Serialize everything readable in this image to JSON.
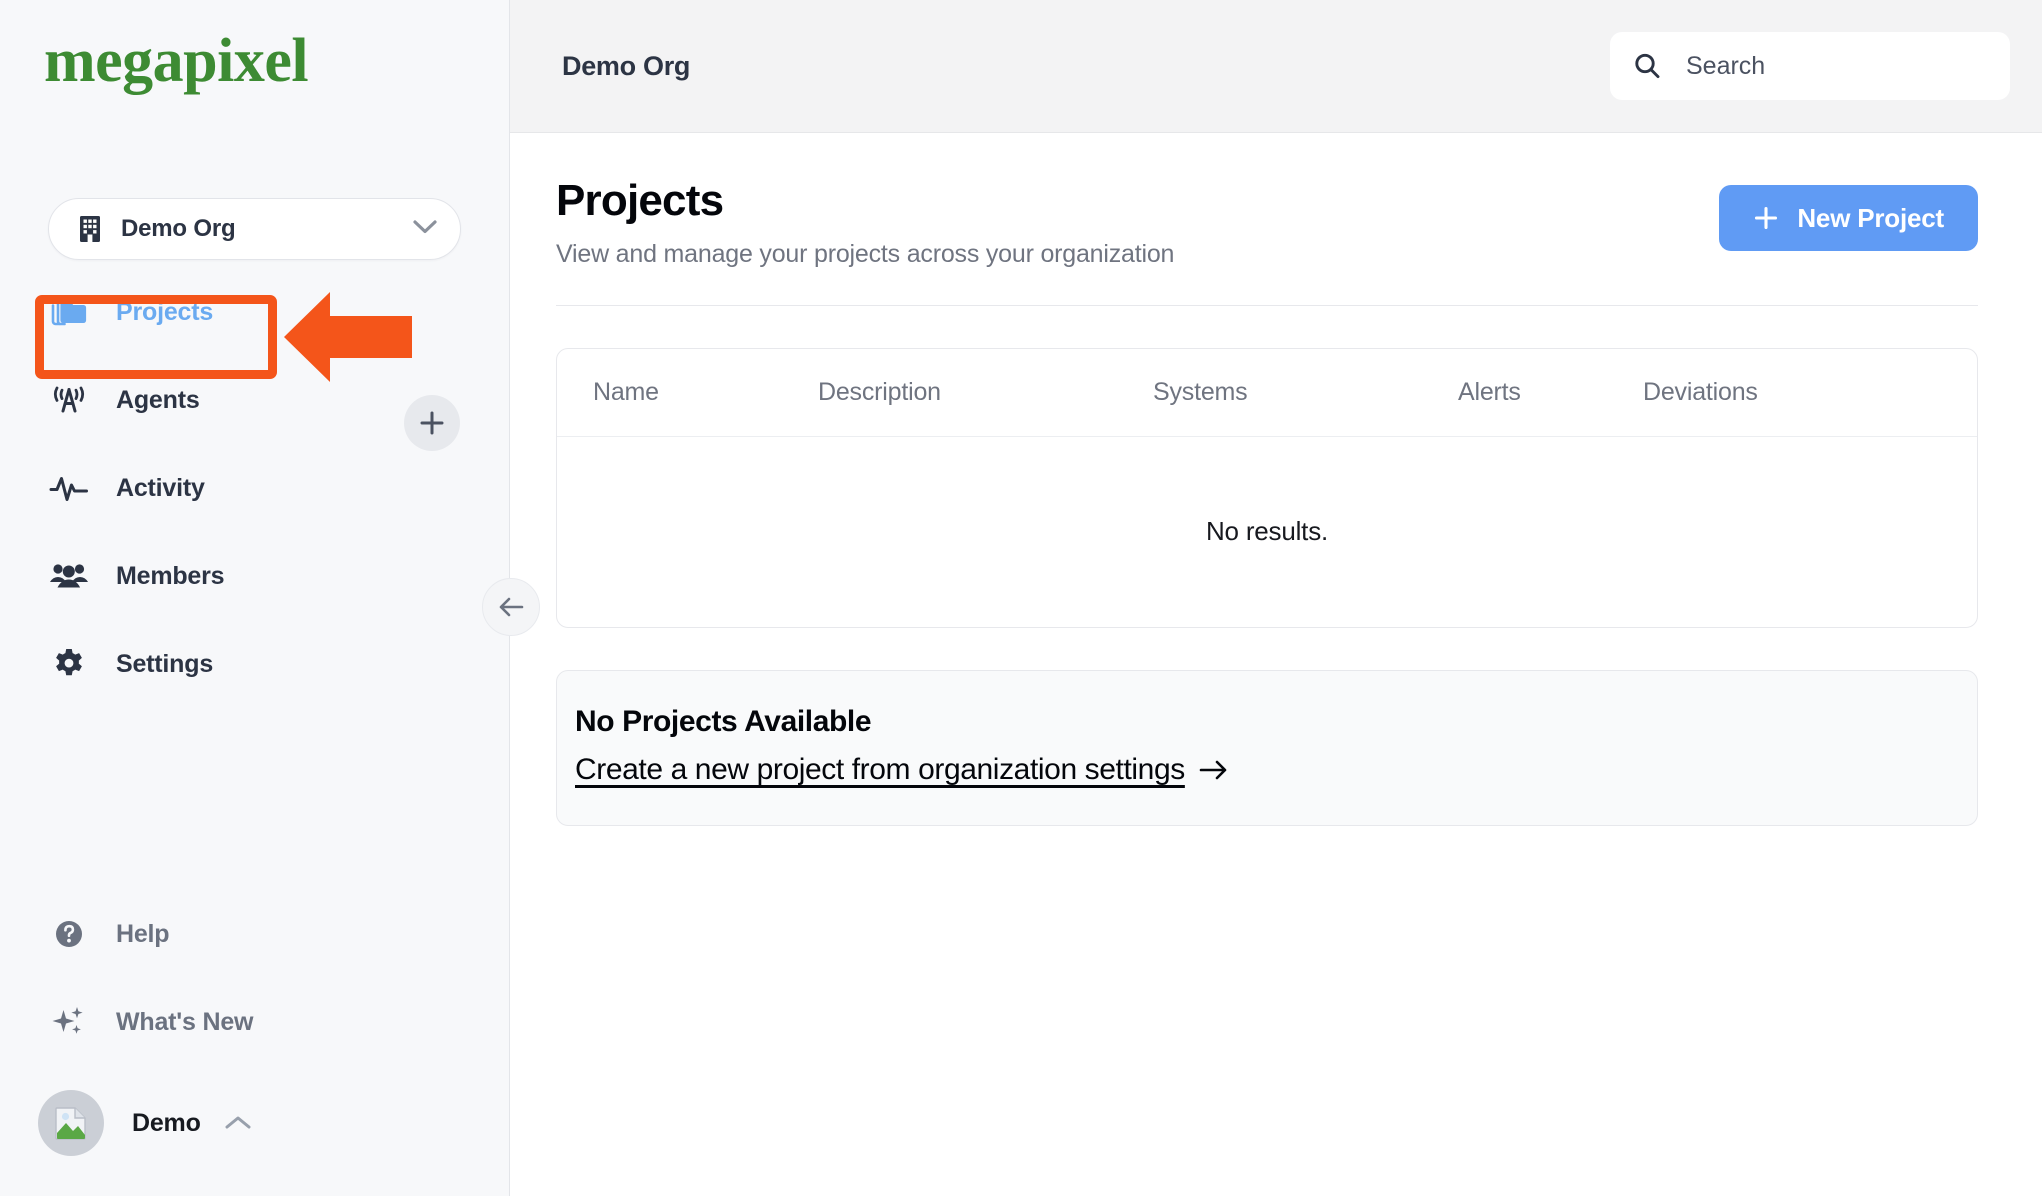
{
  "brand": {
    "logo_text": "megapixel",
    "logo_color": "#3d8b33"
  },
  "sidebar": {
    "org_selector": {
      "name": "Demo Org",
      "icon": "building-icon",
      "chevron": "chevron-down-icon"
    },
    "items": [
      {
        "label": "Projects",
        "icon": "folder-icon",
        "active": true
      },
      {
        "label": "Agents",
        "icon": "antenna-icon",
        "active": false
      },
      {
        "label": "Activity",
        "icon": "pulse-icon",
        "active": false
      },
      {
        "label": "Members",
        "icon": "people-icon",
        "active": false
      },
      {
        "label": "Settings",
        "icon": "gear-icon",
        "active": false
      }
    ],
    "add_agent_button": {
      "icon": "plus-icon"
    },
    "bottom_items": [
      {
        "label": "Help",
        "icon": "question-circle-icon"
      },
      {
        "label": "What's New",
        "icon": "sparkles-icon"
      }
    ],
    "user": {
      "name": "Demo",
      "avatar_icon": "image-placeholder-icon",
      "caret": "chevron-up-icon"
    },
    "collapse_button": {
      "icon": "arrow-left-icon"
    },
    "active_accent_color": "#6aaaf0"
  },
  "topbar": {
    "title": "Demo Org",
    "search": {
      "placeholder": "Search",
      "value": "",
      "icon": "search-icon"
    }
  },
  "page": {
    "title": "Projects",
    "subtitle": "View and manage your projects across your organization",
    "new_project_button": {
      "label": "New Project",
      "icon": "plus-icon",
      "color": "#609bf4"
    }
  },
  "table": {
    "columns": [
      "Name",
      "Description",
      "Systems",
      "Alerts",
      "Deviations"
    ],
    "rows": [],
    "empty_message": "No results."
  },
  "notice": {
    "title": "No Projects Available",
    "link_text": "Create a new project from organization settings",
    "link_icon": "arrow-right-icon"
  },
  "annotation": {
    "color": "#f4551a",
    "target": "Projects",
    "shapes": [
      "highlight-box",
      "pointer-arrow"
    ]
  }
}
